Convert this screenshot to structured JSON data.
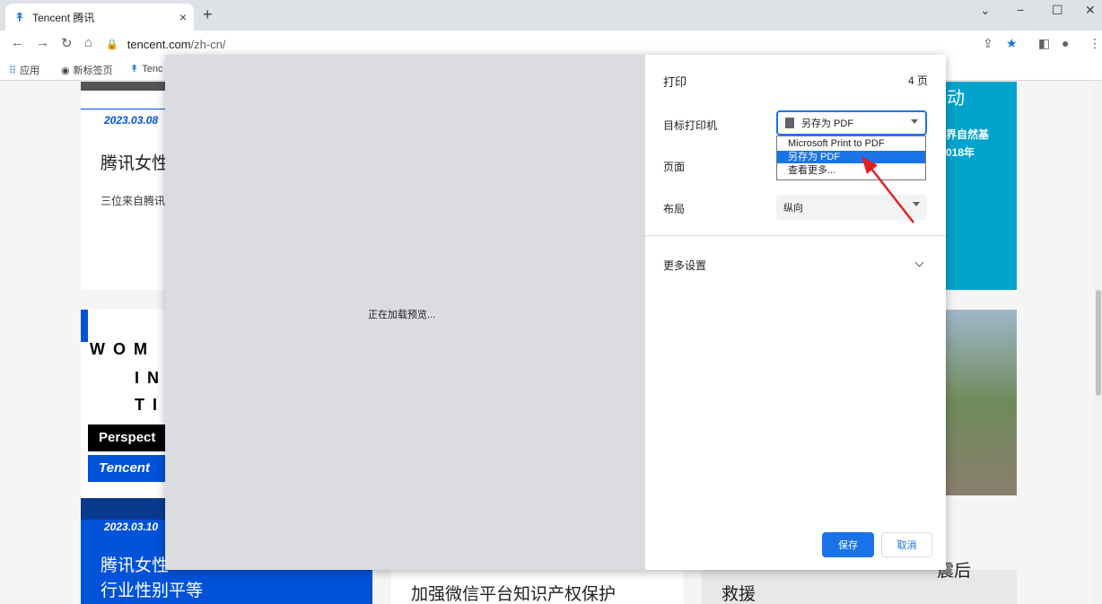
{
  "browser": {
    "tab_title": "Tencent 腾讯",
    "tab_close": "×",
    "new_tab": "+",
    "url_host": "tencent.com",
    "url_path": "/zh-cn/",
    "bookmarks": [
      "应用",
      "新标签页",
      "Tenc"
    ]
  },
  "print_dialog": {
    "title": "打印",
    "page_count": "4 页",
    "destination_label": "目标打印机",
    "destination_value": "另存为 PDF",
    "destination_options": [
      "Microsoft Print to PDF",
      "另存为 PDF",
      "查看更多..."
    ],
    "selected_option_index": 1,
    "pages_label": "页面",
    "layout_label": "布局",
    "layout_value": "纵向",
    "more_settings": "更多设置",
    "loading_text": "正在加载预览...",
    "save_button": "保存",
    "cancel_button": "取消"
  },
  "background_page": {
    "date1": "2023.03.08",
    "title1": "腾讯女性",
    "desc1": "三位来自腾讯",
    "right_top_fragment": "动",
    "right_text1": "界自然基",
    "right_text2": "018年",
    "wom_lines": [
      "W O M",
      "I N",
      "T I"
    ],
    "perspect": "Perspect",
    "tencent_label": "Tencent",
    "date2": "2023.03.10",
    "bottom_title1_line1": "腾讯女性",
    "bottom_title1_line2": "行业性别平等",
    "bottom_title2_line2": "加强微信平台知识产权保护",
    "bottom_title3_line2": "救援",
    "bottom_title3_fragment": "震后"
  },
  "colors": {
    "accent": "#1a73e8",
    "tencent_blue": "#0052d9",
    "teal": "#00a3cc"
  }
}
